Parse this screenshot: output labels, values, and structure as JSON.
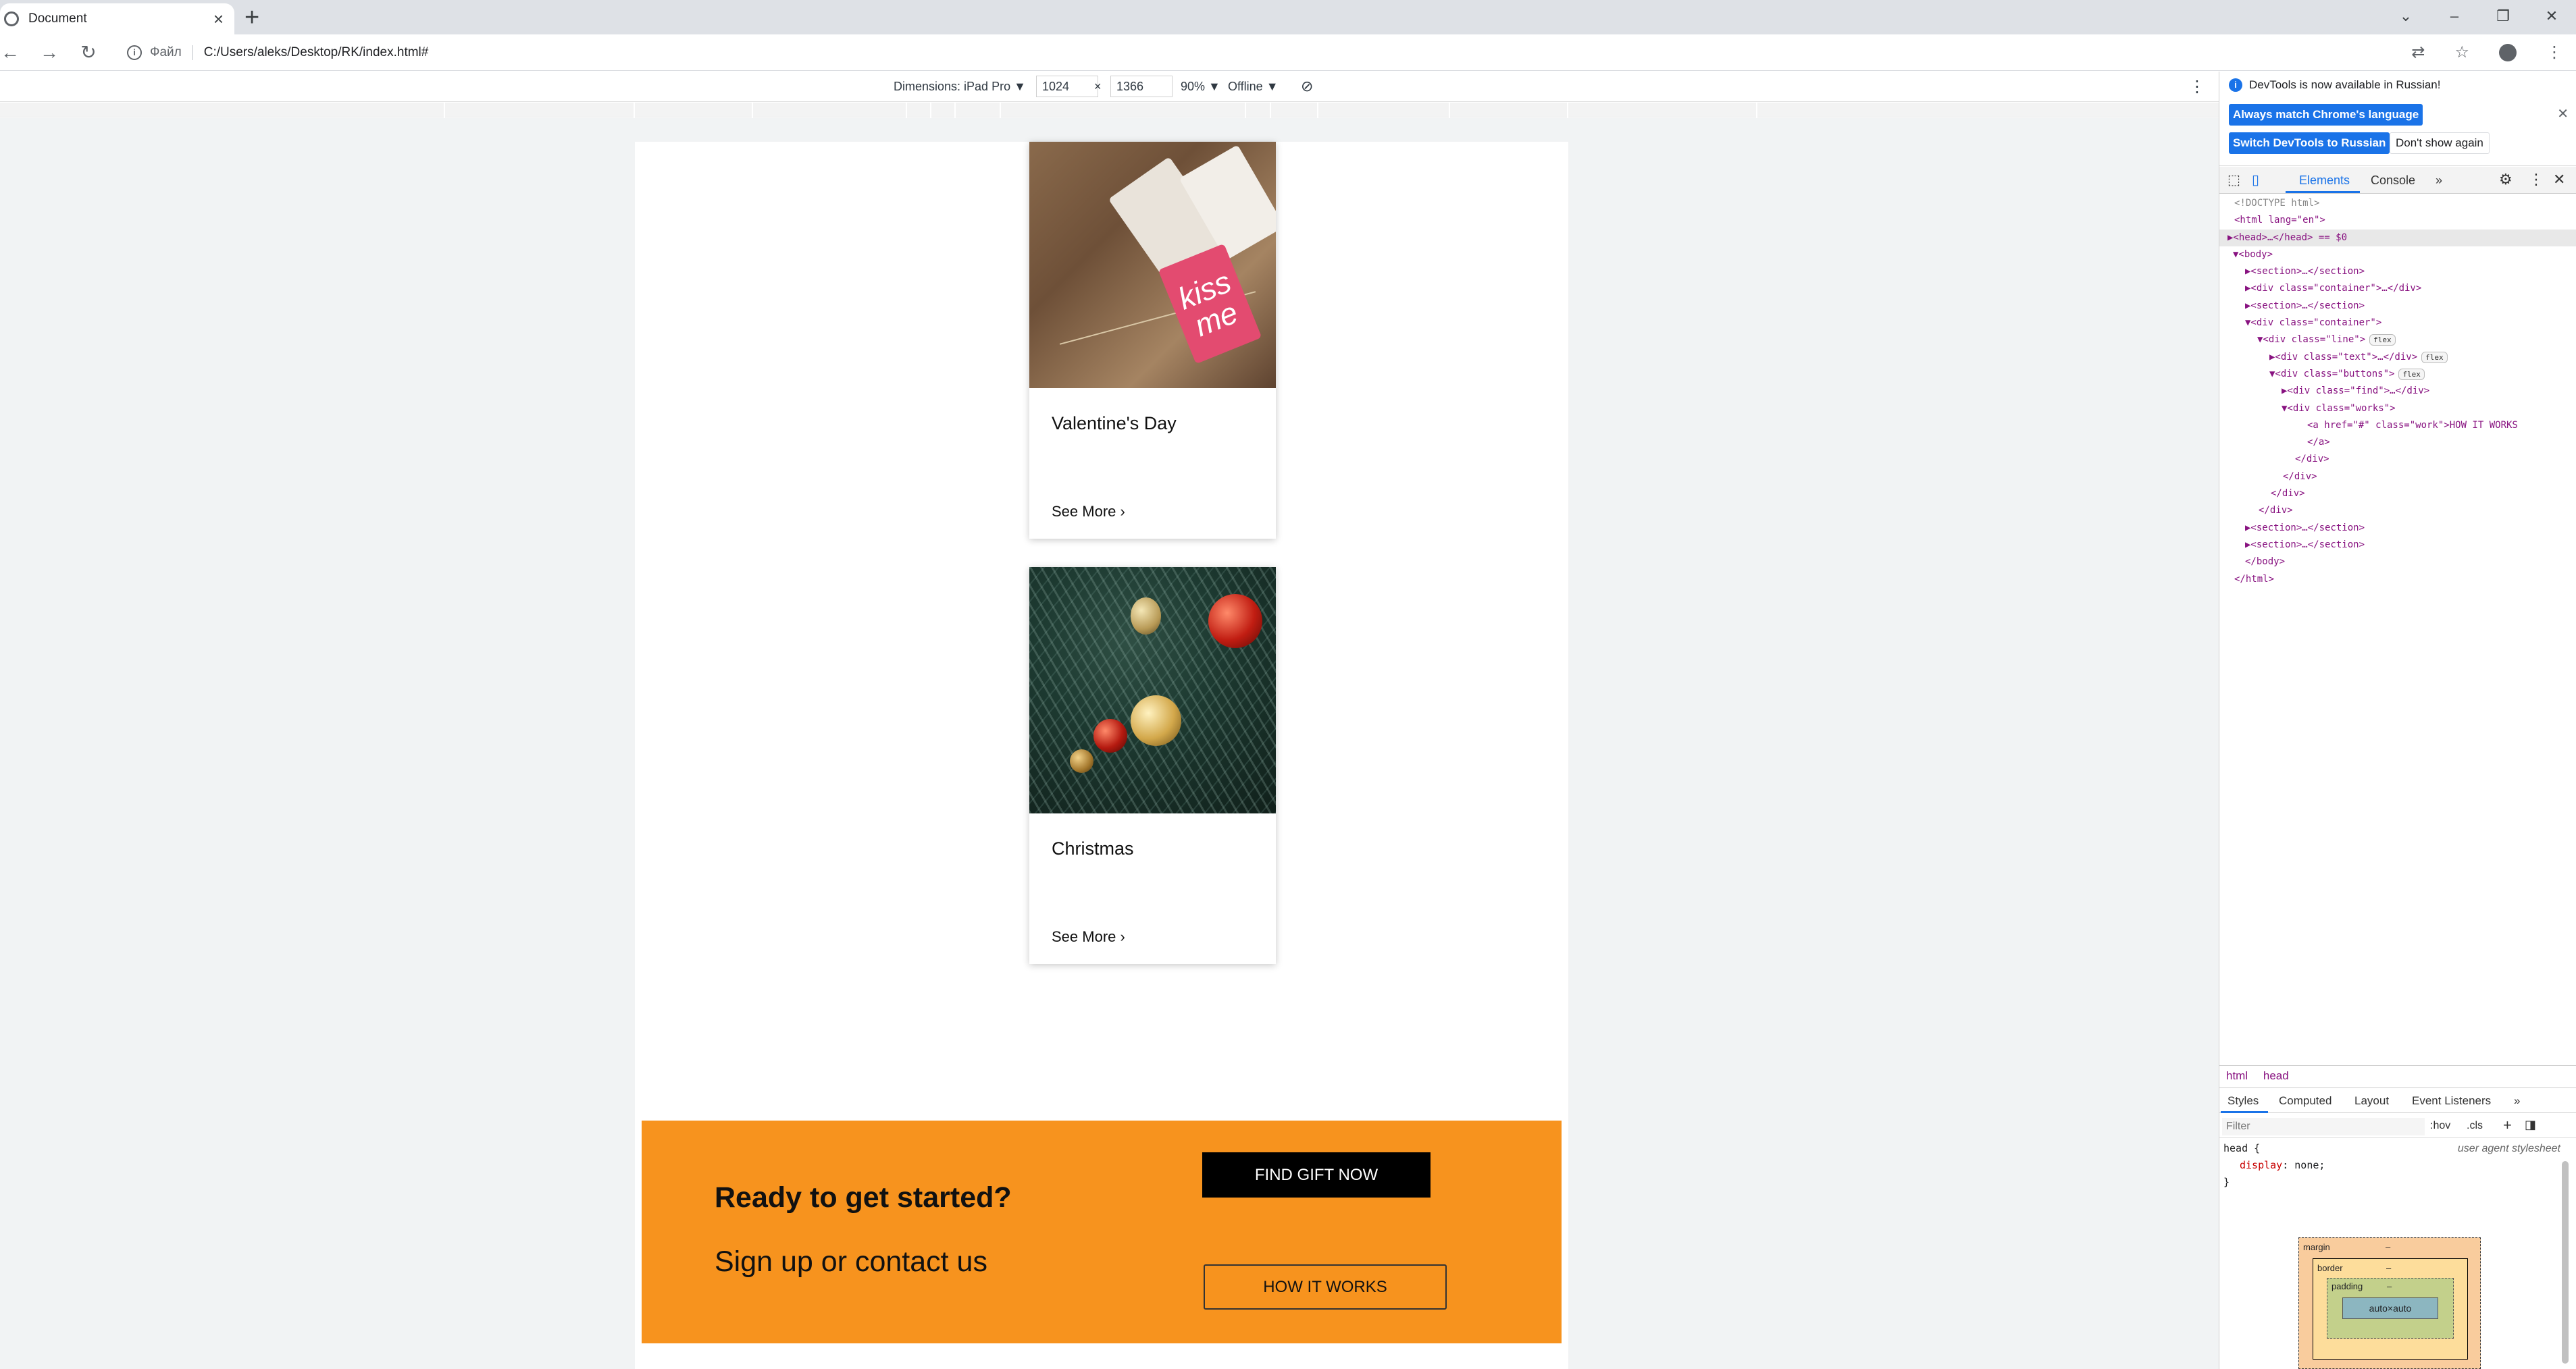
{
  "browser": {
    "tab_title": "Document",
    "tab_close": "×",
    "new_tab": "+",
    "scheme_label": "Файл",
    "url": "C:/Users/aleks/Desktop/RK/index.html#"
  },
  "device_toolbar": {
    "dimensions_label": "Dimensions: iPad Pro ▼",
    "width": "1024",
    "times": "×",
    "height": "1366",
    "zoom": "90% ▼",
    "throttle": "Offline ▼"
  },
  "cards": [
    {
      "title": "Valentine's Day",
      "link": "See More ›",
      "tag_text": "kiss me"
    },
    {
      "title": "Christmas",
      "link": "See More ›"
    }
  ],
  "cta": {
    "heading": "Ready to get started?",
    "subheading": "Sign up or contact us",
    "find_button": "FIND GIFT NOW",
    "works_button": "HOW IT WORKS",
    "background_color": "#f7931e"
  },
  "devtools": {
    "info_message": "DevTools is now available in Russian!",
    "btn_match_language": "Always match Chrome's language",
    "btn_switch_russian": "Switch DevTools to Russian",
    "btn_dont_show": "Don't show again",
    "tab_elements": "Elements",
    "tab_console": "Console",
    "tab_more": "»",
    "dom_lines": [
      "<!DOCTYPE html>",
      "<html lang=\"en\">",
      "▶<head>…</head> == $0",
      "▼<body>",
      "▶<section>…</section>",
      "▶<div class=\"container\">…</div>",
      "▶<section>…</section>",
      "▼<div class=\"container\">",
      "▼<div class=\"line\">",
      "▶<div class=\"text\">…</div>",
      "▼<div class=\"buttons\">",
      "▶<div class=\"find\">…</div>",
      "▼<div class=\"works\">",
      "<a href=\"#\" class=\"work\">HOW IT WORKS",
      "</a>",
      "</div>",
      "</div>",
      "</div>",
      "</div>",
      "▶<section>…</section>",
      "▶<section>…</section>",
      "</body>",
      "</html>"
    ],
    "badge_flex": "flex",
    "breadcrumbs": [
      "html",
      "head"
    ],
    "style_tabs": [
      "Styles",
      "Computed",
      "Layout",
      "Event Listeners",
      "»"
    ],
    "filter_placeholder": "Filter",
    "hov": ":hov",
    "cls": ".cls",
    "plus": "+",
    "rule_selector": "head {",
    "rule_origin": "user agent stylesheet",
    "rule_prop": "display",
    "rule_value": "none;",
    "rule_close": "}",
    "box_model": {
      "margin_label": "margin",
      "border_label": "border",
      "padding_label": "padding",
      "content": "auto×auto",
      "dash": "–"
    }
  }
}
